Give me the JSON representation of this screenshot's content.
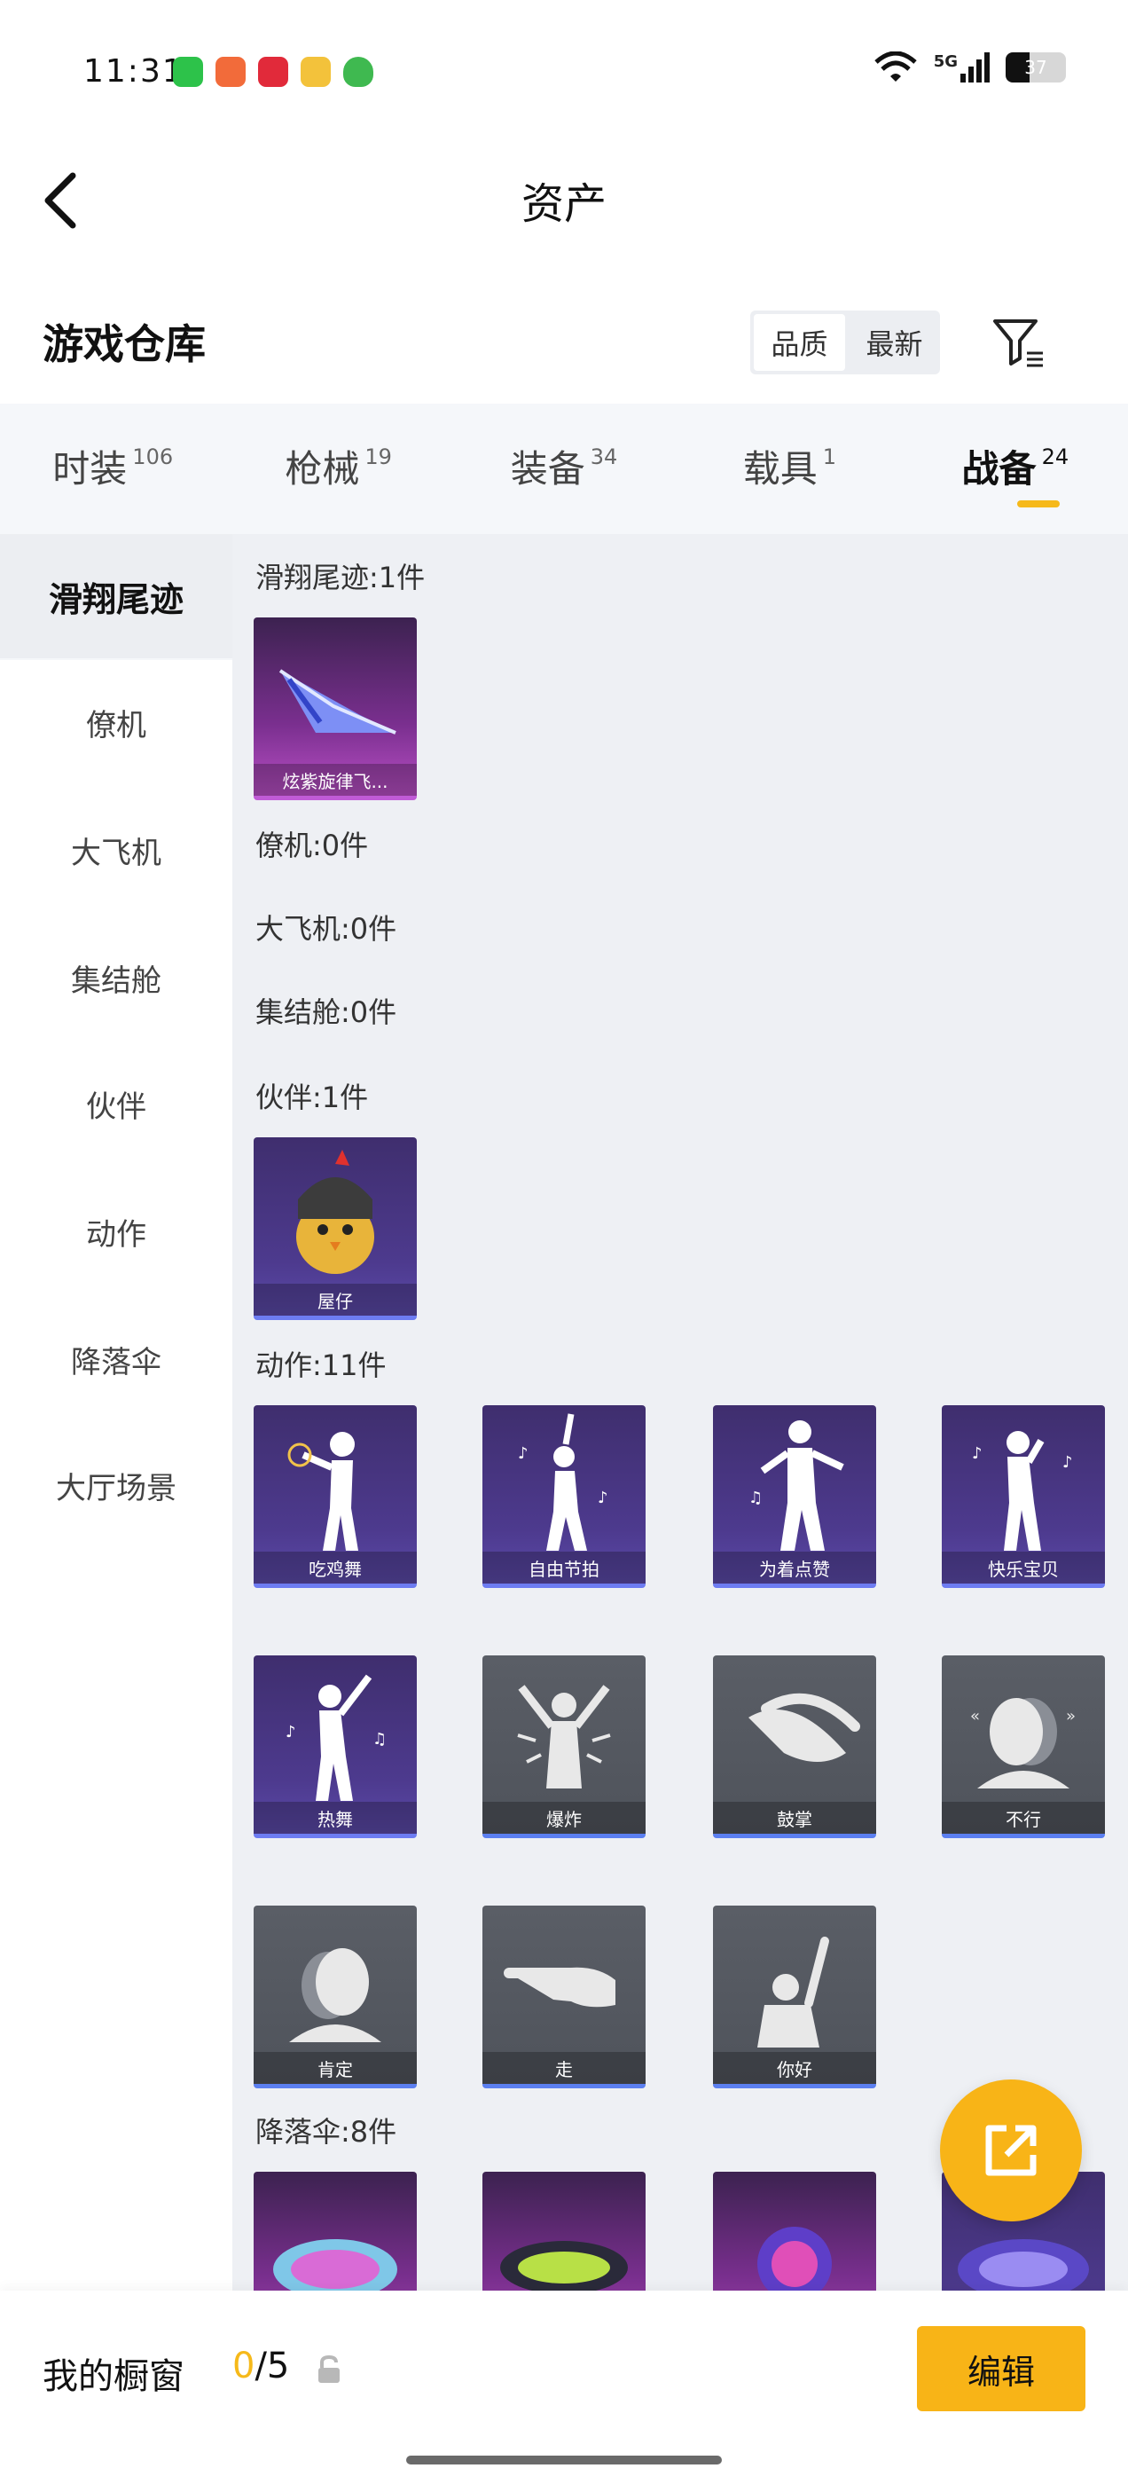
{
  "status": {
    "time": "11:31",
    "network": "5G",
    "battery": "37"
  },
  "header": {
    "title": "资产"
  },
  "warehouse": {
    "title": "游戏仓库",
    "sort_options": [
      "品质",
      "最新"
    ]
  },
  "tabs": [
    {
      "label": "时装",
      "count": "106"
    },
    {
      "label": "枪械",
      "count": "19"
    },
    {
      "label": "装备",
      "count": "34"
    },
    {
      "label": "载具",
      "count": "1"
    },
    {
      "label": "战备",
      "count": "24"
    }
  ],
  "sidebar": {
    "items": [
      "滑翔尾迹",
      "僚机",
      "大飞机",
      "集结舱",
      "伙伴",
      "动作",
      "降落伞",
      "大厅场景"
    ]
  },
  "sections": {
    "trail": {
      "label": "滑翔尾迹:1件",
      "items": [
        "炫紫旋律飞..."
      ]
    },
    "wingman": {
      "label": "僚机:0件"
    },
    "plane": {
      "label": "大飞机:0件"
    },
    "pod": {
      "label": "集结舱:0件"
    },
    "partner": {
      "label": "伙伴:1件",
      "items": [
        "屋仔"
      ]
    },
    "emote": {
      "label": "动作:11件",
      "items": [
        "吃鸡舞",
        "自由节拍",
        "为着点赞",
        "快乐宝贝",
        "热舞",
        "爆炸",
        "鼓掌",
        "不行",
        "肯定",
        "走",
        "你好"
      ]
    },
    "parachute": {
      "label": "降落伞:8件"
    }
  },
  "bottom": {
    "showcase_label": "我的橱窗",
    "showcase_current": "0",
    "showcase_total": "/5",
    "edit_label": "编辑"
  },
  "colors": {
    "accent": "#f8b417",
    "purple_card": "#4d3a8e",
    "gray_card": "#54585f",
    "magenta_card": "#7a2f8f"
  }
}
